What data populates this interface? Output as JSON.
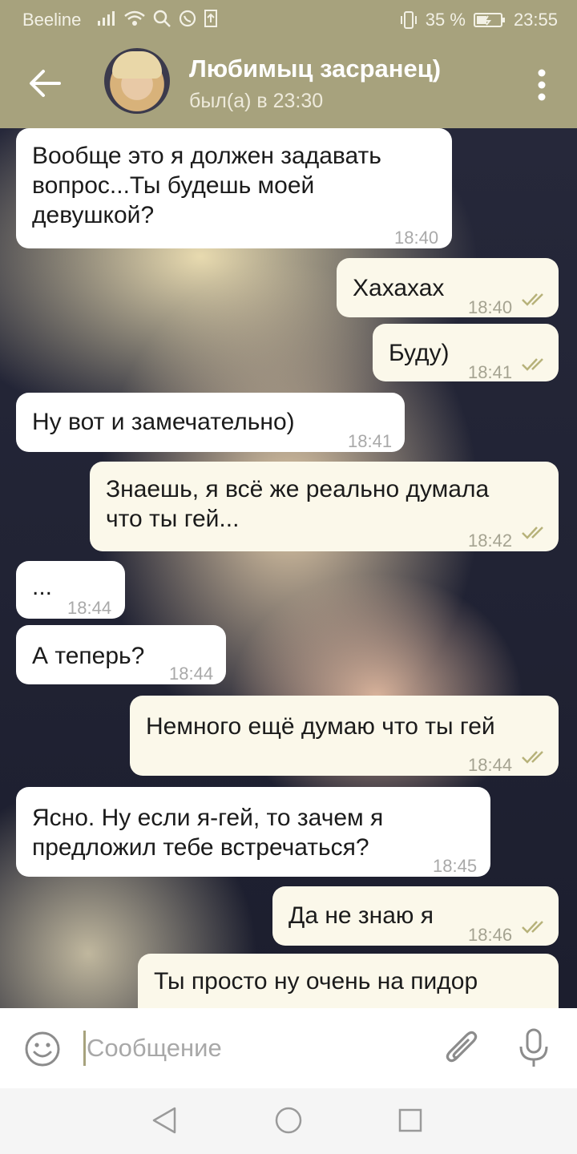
{
  "status_bar": {
    "carrier": "Beeline",
    "battery": "35 %",
    "time": "23:55"
  },
  "header": {
    "title": "Любимыц засранец)",
    "subtitle": "был(а) в 23:30"
  },
  "messages": [
    {
      "dir": "in",
      "text": "Вообще это я должен задавать\nвопрос...Ты будешь моей\nдевушкой?",
      "time": "18:40"
    },
    {
      "dir": "out",
      "text": "Хахахах",
      "time": "18:40"
    },
    {
      "dir": "out",
      "text": "Буду)",
      "time": "18:41"
    },
    {
      "dir": "in",
      "text": "Ну вот и замечательно)",
      "time": "18:41"
    },
    {
      "dir": "out",
      "text": "Знаешь, я всё же реально думала\nчто ты гей...",
      "time": "18:42"
    },
    {
      "dir": "in",
      "text": "...",
      "time": "18:44"
    },
    {
      "dir": "in",
      "text": "А теперь?",
      "time": "18:44"
    },
    {
      "dir": "out",
      "text": "Немного ещё думаю что ты гей",
      "time": "18:44"
    },
    {
      "dir": "in",
      "text": "Ясно. Ну если я-гей, то зачем я\nпредложил тебе встречаться?",
      "time": "18:45"
    },
    {
      "dir": "out",
      "text": "Да не знаю я",
      "time": "18:46"
    },
    {
      "dir": "out",
      "text": "Ты просто ну очень на пидор",
      "time": ""
    }
  ],
  "input": {
    "placeholder": "Сообщение"
  },
  "colors": {
    "accent": "#a7a27d",
    "outgoing_bubble": "#fbf8ea",
    "incoming_bubble": "#ffffff",
    "read_check": "#b7b27a"
  }
}
